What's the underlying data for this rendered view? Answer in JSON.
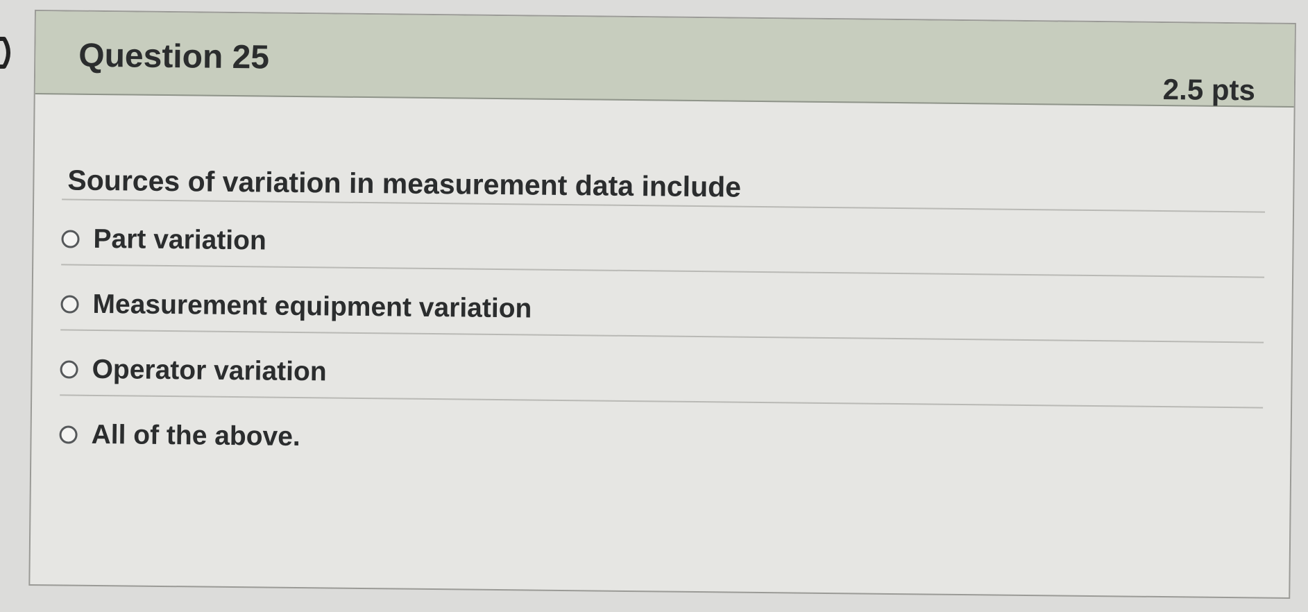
{
  "question": {
    "title": "Question 25",
    "points": "2.5 pts",
    "prompt": "Sources of variation in measurement data include",
    "answers": [
      {
        "label": "Part variation",
        "selected": false
      },
      {
        "label": "Measurement equipment variation",
        "selected": false
      },
      {
        "label": "Operator variation",
        "selected": false
      },
      {
        "label": "All of the above.",
        "selected": false
      }
    ]
  }
}
